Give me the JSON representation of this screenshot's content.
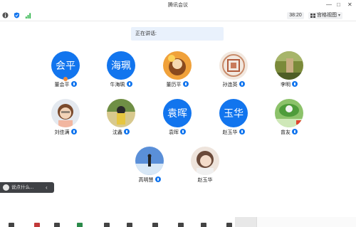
{
  "window": {
    "title": "腾讯会议",
    "minimize": "—",
    "maximize": "□",
    "close": "✕"
  },
  "toolbar": {
    "info_icon": "info-icon",
    "shield_icon": "shield-icon",
    "signal_icon": "signal-icon",
    "timer": "38:20",
    "layout_label": "宫格视图",
    "layout_arrow": "▾"
  },
  "speaking_label": "正在讲话:",
  "participants": [
    {
      "name": "董会平",
      "avatar_text": "会平",
      "muted": false
    },
    {
      "name": "牛海珮",
      "avatar_text": "海珮",
      "muted": false
    },
    {
      "name": "董历平",
      "avatar_text": "",
      "muted": false
    },
    {
      "name": "孙连英",
      "avatar_text": "",
      "muted": false
    },
    {
      "name": "李明",
      "avatar_text": "",
      "muted": false
    },
    {
      "name": "刘佳满",
      "avatar_text": "",
      "muted": false
    },
    {
      "name": "沈鑫",
      "avatar_text": "",
      "muted": false
    },
    {
      "name": "袁晖",
      "avatar_text": "袁晖",
      "muted": false
    },
    {
      "name": "赵玉华",
      "avatar_text": "玉华",
      "muted": false
    },
    {
      "name": "曾友",
      "avatar_text": "",
      "muted": false
    },
    {
      "name": "高明慧",
      "avatar_text": "",
      "muted": false
    },
    {
      "name": "赵玉华",
      "avatar_text": "",
      "muted": false
    }
  ],
  "chat": {
    "placeholder": "说点什么...",
    "collapse": "‹"
  },
  "colors": {
    "accent": "#1275ee",
    "chat_bg": "#3f4145",
    "speaking_bg": "#e9f1fc"
  }
}
